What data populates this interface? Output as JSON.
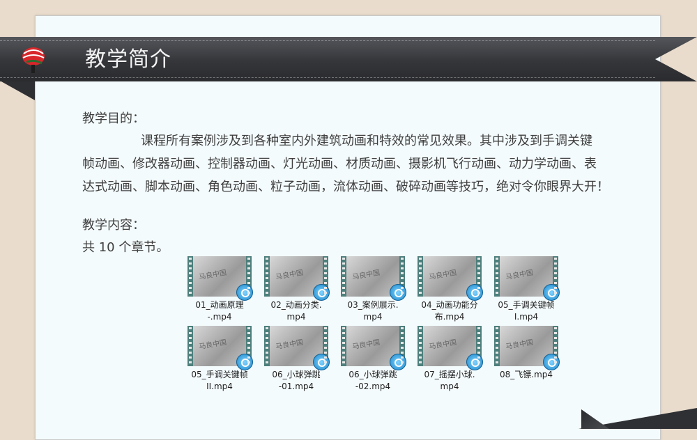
{
  "header": {
    "title": "教学简介"
  },
  "objective": {
    "label": "教学目的：",
    "lines": [
      "课程所有案例涉及到各种室内外建筑动画和特效的常见效果。其中涉及到手调关键",
      "帧动画、修改器动画、控制器动画、灯光动画、材质动画、摄影机飞行动画、动力学动画、表",
      "达式动画、脚本动画、角色动画、粒子动画，流体动画、破碎动画等技巧，绝对令你眼界大开！"
    ]
  },
  "content": {
    "label": "教学内容：",
    "chapters": "共 10 个章节。"
  },
  "files": [
    {
      "line1": "01_动画原理",
      "line2": "-.mp4"
    },
    {
      "line1": "02_动画分类.",
      "line2": "mp4"
    },
    {
      "line1": "03_案例展示.",
      "line2": "mp4"
    },
    {
      "line1": "04_动画功能分",
      "line2": "布.mp4"
    },
    {
      "line1": "05_手调关键帧",
      "line2": "I.mp4"
    },
    {
      "line1": "05_手调关键帧",
      "line2": "II.mp4"
    },
    {
      "line1": "06_小球弹跳",
      "line2": "-01.mp4"
    },
    {
      "line1": "06_小球弹跳",
      "line2": "-02.mp4"
    },
    {
      "line1": "07_摇摆小球.",
      "line2": "mp4"
    },
    {
      "line1": "08_飞镖.mp4",
      "line2": ""
    }
  ],
  "colors": {
    "ribbon": "#3a3b3f",
    "paper": "#f4fbfd",
    "background": "#e9dccc",
    "film": "#4d7f7c"
  }
}
